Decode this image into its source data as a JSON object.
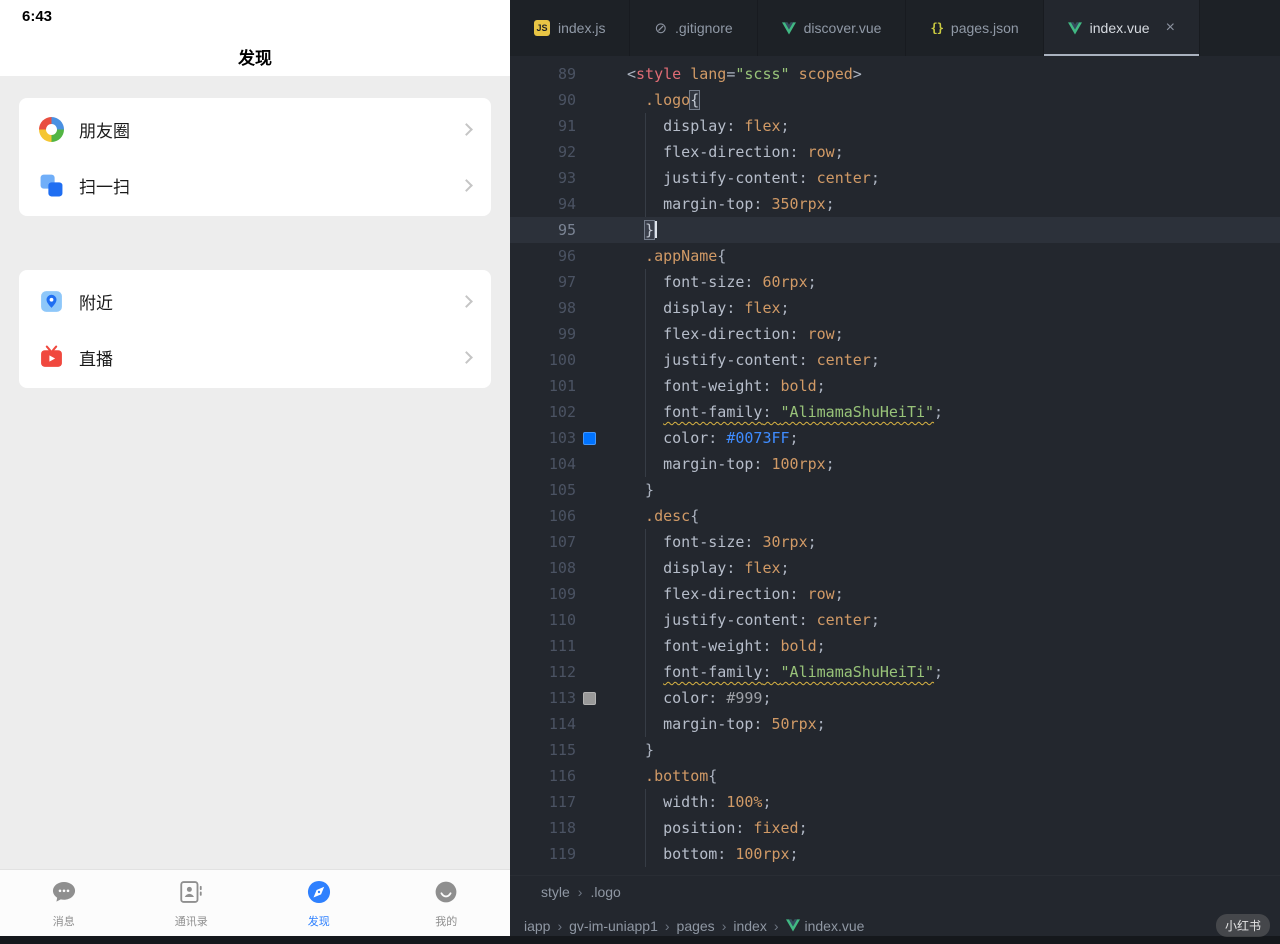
{
  "phone": {
    "status_time": "6:43",
    "nav_title": "发现",
    "groups": [
      {
        "items": [
          {
            "icon": "moments",
            "label": "朋友圈"
          },
          {
            "icon": "scan",
            "label": "扫一扫"
          }
        ]
      },
      {
        "items": [
          {
            "icon": "nearby",
            "label": "附近"
          },
          {
            "icon": "live",
            "label": "直播"
          }
        ]
      }
    ],
    "tabbar": {
      "active_color": "#2e80fe",
      "inactive_color": "#8f8f8f",
      "items": [
        {
          "icon": "chat",
          "label": "消息",
          "active": false
        },
        {
          "icon": "contacts",
          "label": "通讯录",
          "active": false
        },
        {
          "icon": "discover",
          "label": "发现",
          "active": true
        },
        {
          "icon": "me",
          "label": "我的",
          "active": false
        }
      ]
    }
  },
  "editor": {
    "tabs": [
      {
        "icon": "js",
        "label": "index.js",
        "active": false
      },
      {
        "icon": "gitignore",
        "label": ".gitignore",
        "active": false
      },
      {
        "icon": "vue",
        "label": "discover.vue",
        "active": false
      },
      {
        "icon": "json",
        "label": "pages.json",
        "active": false
      },
      {
        "icon": "vue",
        "label": "index.vue",
        "active": true
      }
    ],
    "close_glyph": "×",
    "separator": "›",
    "symbol_breadcrumb": [
      {
        "label": "style"
      },
      {
        "label": ".logo"
      }
    ],
    "path_breadcrumb": [
      {
        "label": "iapp"
      },
      {
        "label": "gv-im-uniapp1"
      },
      {
        "label": "pages"
      },
      {
        "label": "index"
      },
      {
        "label": "index.vue",
        "icon": "vue"
      }
    ],
    "watermark": "小红书",
    "code": {
      "lines": [
        {
          "n": 89,
          "i": 0,
          "t": [
            [
              "p",
              "<"
            ],
            [
              "tag",
              "style"
            ],
            [
              "p",
              " "
            ],
            [
              "attr",
              "lang"
            ],
            [
              "p",
              "="
            ],
            [
              "str",
              "\"scss\""
            ],
            [
              "p",
              " "
            ],
            [
              "attr",
              "scoped"
            ],
            [
              "p",
              ">"
            ]
          ]
        },
        {
          "n": 90,
          "i": 1,
          "t": [
            [
              "sel",
              ".logo"
            ],
            [
              "bm",
              "{"
            ]
          ]
        },
        {
          "n": 91,
          "i": 2,
          "t": [
            [
              "prop",
              "display"
            ],
            [
              "p",
              ": "
            ],
            [
              "val",
              "flex"
            ],
            [
              "p",
              ";"
            ]
          ]
        },
        {
          "n": 92,
          "i": 2,
          "t": [
            [
              "prop",
              "flex-direction"
            ],
            [
              "p",
              ": "
            ],
            [
              "val",
              "row"
            ],
            [
              "p",
              ";"
            ]
          ]
        },
        {
          "n": 93,
          "i": 2,
          "t": [
            [
              "prop",
              "justify-content"
            ],
            [
              "p",
              ": "
            ],
            [
              "val",
              "center"
            ],
            [
              "p",
              ";"
            ]
          ]
        },
        {
          "n": 94,
          "i": 2,
          "t": [
            [
              "prop",
              "margin-top"
            ],
            [
              "p",
              ": "
            ],
            [
              "num",
              "350rpx"
            ],
            [
              "p",
              ";"
            ]
          ]
        },
        {
          "n": 95,
          "i": 1,
          "hl": true,
          "cur": true,
          "t": [
            [
              "bm",
              "}"
            ]
          ]
        },
        {
          "n": 96,
          "i": 1,
          "t": [
            [
              "sel",
              ".appName"
            ],
            [
              "p",
              "{"
            ]
          ]
        },
        {
          "n": 97,
          "i": 2,
          "t": [
            [
              "prop",
              "font-size"
            ],
            [
              "p",
              ": "
            ],
            [
              "num",
              "60rpx"
            ],
            [
              "p",
              ";"
            ]
          ]
        },
        {
          "n": 98,
          "i": 2,
          "t": [
            [
              "prop",
              "display"
            ],
            [
              "p",
              ": "
            ],
            [
              "val",
              "flex"
            ],
            [
              "p",
              ";"
            ]
          ]
        },
        {
          "n": 99,
          "i": 2,
          "t": [
            [
              "prop",
              "flex-direction"
            ],
            [
              "p",
              ": "
            ],
            [
              "val",
              "row"
            ],
            [
              "p",
              ";"
            ]
          ]
        },
        {
          "n": 100,
          "i": 2,
          "t": [
            [
              "prop",
              "justify-content"
            ],
            [
              "p",
              ": "
            ],
            [
              "val",
              "center"
            ],
            [
              "p",
              ";"
            ]
          ]
        },
        {
          "n": 101,
          "i": 2,
          "t": [
            [
              "prop",
              "font-weight"
            ],
            [
              "p",
              ": "
            ],
            [
              "val",
              "bold"
            ],
            [
              "p",
              ";"
            ]
          ]
        },
        {
          "n": 102,
          "i": 2,
          "t": [
            [
              "prop",
              "font-family",
              1
            ],
            [
              "p",
              ": ",
              1
            ],
            [
              "str",
              "\"AlimamaShuHeiTi\"",
              1
            ],
            [
              "p",
              ";"
            ]
          ]
        },
        {
          "n": 103,
          "i": 2,
          "sw": "#0073FF",
          "t": [
            [
              "prop",
              "color"
            ],
            [
              "p",
              ": "
            ],
            [
              "c1",
              "#0073FF"
            ],
            [
              "p",
              ";"
            ]
          ]
        },
        {
          "n": 104,
          "i": 2,
          "t": [
            [
              "prop",
              "margin-top"
            ],
            [
              "p",
              ": "
            ],
            [
              "num",
              "100rpx"
            ],
            [
              "p",
              ";"
            ]
          ]
        },
        {
          "n": 105,
          "i": 1,
          "t": [
            [
              "p",
              "}"
            ]
          ]
        },
        {
          "n": 106,
          "i": 1,
          "t": [
            [
              "sel",
              ".desc"
            ],
            [
              "p",
              "{"
            ]
          ]
        },
        {
          "n": 107,
          "i": 2,
          "t": [
            [
              "prop",
              "font-size"
            ],
            [
              "p",
              ": "
            ],
            [
              "num",
              "30rpx"
            ],
            [
              "p",
              ";"
            ]
          ]
        },
        {
          "n": 108,
          "i": 2,
          "t": [
            [
              "prop",
              "display"
            ],
            [
              "p",
              ": "
            ],
            [
              "val",
              "flex"
            ],
            [
              "p",
              ";"
            ]
          ]
        },
        {
          "n": 109,
          "i": 2,
          "t": [
            [
              "prop",
              "flex-direction"
            ],
            [
              "p",
              ": "
            ],
            [
              "val",
              "row"
            ],
            [
              "p",
              ";"
            ]
          ]
        },
        {
          "n": 110,
          "i": 2,
          "t": [
            [
              "prop",
              "justify-content"
            ],
            [
              "p",
              ": "
            ],
            [
              "val",
              "center"
            ],
            [
              "p",
              ";"
            ]
          ]
        },
        {
          "n": 111,
          "i": 2,
          "t": [
            [
              "prop",
              "font-weight"
            ],
            [
              "p",
              ": "
            ],
            [
              "val",
              "bold"
            ],
            [
              "p",
              ";"
            ]
          ]
        },
        {
          "n": 112,
          "i": 2,
          "t": [
            [
              "prop",
              "font-family",
              1
            ],
            [
              "p",
              ": ",
              1
            ],
            [
              "str",
              "\"AlimamaShuHeiTi\"",
              1
            ],
            [
              "p",
              ";"
            ]
          ]
        },
        {
          "n": 113,
          "i": 2,
          "sw": "#999999",
          "t": [
            [
              "prop",
              "color"
            ],
            [
              "p",
              ": "
            ],
            [
              "c2",
              "#999"
            ],
            [
              "p",
              ";"
            ]
          ]
        },
        {
          "n": 114,
          "i": 2,
          "t": [
            [
              "prop",
              "margin-top"
            ],
            [
              "p",
              ": "
            ],
            [
              "num",
              "50rpx"
            ],
            [
              "p",
              ";"
            ]
          ]
        },
        {
          "n": 115,
          "i": 1,
          "t": [
            [
              "p",
              "}"
            ]
          ]
        },
        {
          "n": 116,
          "i": 1,
          "t": [
            [
              "sel",
              ".bottom"
            ],
            [
              "p",
              "{"
            ]
          ]
        },
        {
          "n": 117,
          "i": 2,
          "t": [
            [
              "prop",
              "width"
            ],
            [
              "p",
              ": "
            ],
            [
              "num",
              "100%"
            ],
            [
              "p",
              ";"
            ]
          ]
        },
        {
          "n": 118,
          "i": 2,
          "t": [
            [
              "prop",
              "position"
            ],
            [
              "p",
              ": "
            ],
            [
              "val",
              "fixed"
            ],
            [
              "p",
              ";"
            ]
          ]
        },
        {
          "n": 119,
          "i": 2,
          "t": [
            [
              "prop",
              "bottom"
            ],
            [
              "p",
              ": "
            ],
            [
              "num",
              "100rpx"
            ],
            [
              "p",
              ";"
            ]
          ]
        }
      ]
    }
  }
}
